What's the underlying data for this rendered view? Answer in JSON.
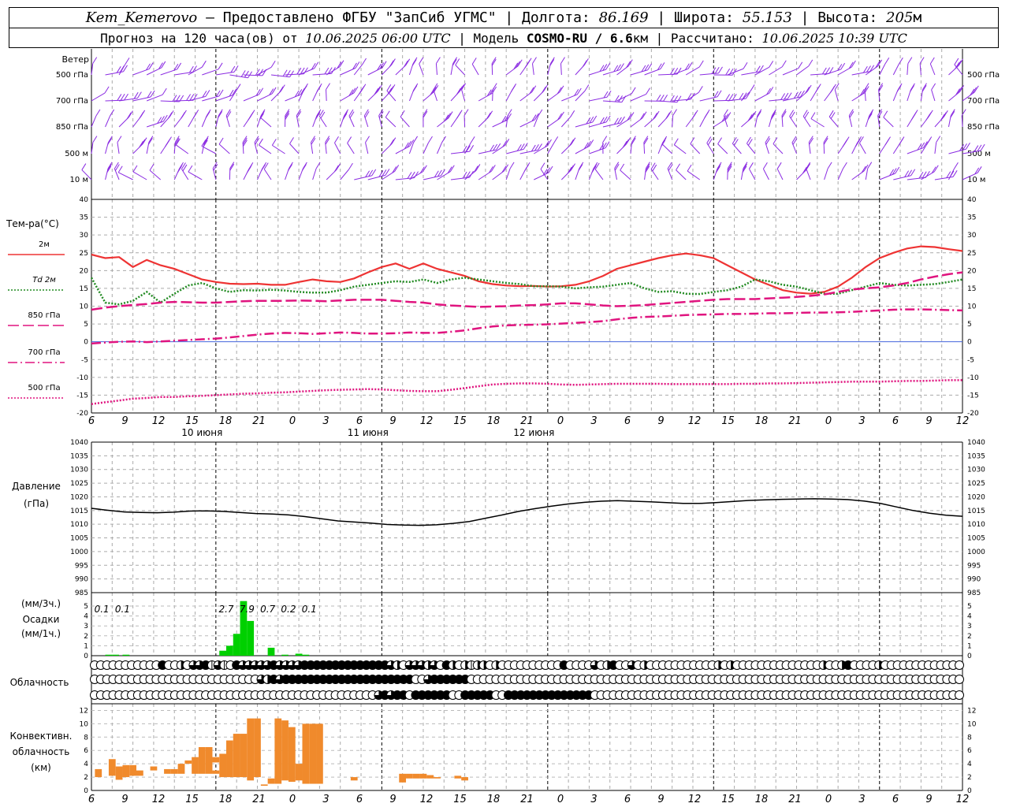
{
  "header": {
    "station": "Kem_Kemerovo",
    "provider": " — Предоставлено ФГБУ \"ЗапСиб УГМС\"",
    "lon_label": " | Долгота: ",
    "lon": "86.169",
    "lat_label": " | Широта: ",
    "lat": "55.153",
    "alt_label": " | Высота: ",
    "alt": "205",
    "alt_unit": "м",
    "forecast_label": "Прогноз на 120 часа(ов) от ",
    "start": "10.06.2025 06:00 UTC",
    "model_label": "  | Модель ",
    "model": "COSMO-RU / 6.6",
    "model_unit": "км",
    "calc_label": " | Рассчитано: ",
    "calc": "10.06.2025 10:39 UTC"
  },
  "chart_data": {
    "type": "meteogram",
    "x_hours": [
      6,
      9,
      12,
      15,
      18,
      21,
      0,
      3,
      6,
      9,
      12,
      15,
      18,
      21,
      0,
      3,
      6,
      9,
      12,
      15,
      18,
      21,
      0,
      3,
      6,
      9,
      12
    ],
    "days": [
      "10 июня",
      "11 июня",
      "12 июня"
    ],
    "wind": {
      "title": "Ветер",
      "levels": [
        "500 гПа",
        "700 гПа",
        "850 гПа",
        "500 м",
        "10 м"
      ],
      "color": "#8a2be2"
    },
    "temperature": {
      "title": "Тем-ра(°C)",
      "ylim": [
        -20,
        40
      ],
      "yticks": [
        40,
        35,
        30,
        25,
        20,
        15,
        10,
        5,
        0,
        -5,
        -10,
        -15,
        -20
      ],
      "series": [
        {
          "name": "2м",
          "color": "#ee3333",
          "dash": "solid",
          "values": [
            24.5,
            23.5,
            23.8,
            21.0,
            23.0,
            21.5,
            20.5,
            19.0,
            17.5,
            16.8,
            16.3,
            16.2,
            16.3,
            16.0,
            16.0,
            16.8,
            17.5,
            17.0,
            16.8,
            17.8,
            19.5,
            21.0,
            22.0,
            20.5,
            22.0,
            20.5,
            19.5,
            18.5,
            17.0,
            16.2,
            15.8,
            15.6,
            15.7,
            15.5,
            15.6,
            16.0,
            17.0,
            18.5,
            20.5,
            21.5,
            22.5,
            23.5,
            24.3,
            24.8,
            24.3,
            23.5,
            21.5,
            19.5,
            17.5,
            16.0,
            14.5,
            13.8,
            13.5,
            14.0,
            15.5,
            18.0,
            21.0,
            23.5,
            25.0,
            26.2,
            26.8,
            26.6,
            26.0,
            25.5
          ]
        },
        {
          "name": "Td 2м",
          "color": "#228b22",
          "dash": "dotted",
          "values": [
            18.0,
            11.0,
            10.5,
            11.5,
            14.0,
            11.0,
            13.5,
            15.8,
            16.5,
            15.0,
            14.0,
            14.5,
            14.4,
            14.6,
            14.4,
            14.0,
            13.8,
            13.8,
            14.5,
            15.5,
            16.0,
            16.5,
            17.0,
            16.8,
            17.5,
            16.5,
            17.5,
            18.0,
            17.5,
            17.0,
            16.5,
            16.2,
            15.6,
            15.6,
            15.5,
            15.0,
            15.3,
            15.5,
            16.0,
            16.5,
            15.0,
            14.0,
            14.2,
            13.5,
            13.4,
            14.0,
            14.5,
            15.5,
            17.5,
            17.0,
            16.0,
            15.5,
            14.5,
            13.5,
            13.5,
            14.5,
            15.5,
            16.5,
            16.0,
            15.8,
            16.0,
            16.2,
            16.8,
            17.5
          ]
        },
        {
          "name": "850 гПа",
          "color": "#e0147f",
          "dash": "long-dash",
          "values": [
            9.0,
            9.6,
            10.0,
            10.3,
            10.6,
            11.0,
            11.2,
            11.1,
            11.0,
            11.0,
            11.2,
            11.4,
            11.5,
            11.5,
            11.5,
            11.6,
            11.5,
            11.4,
            11.6,
            11.8,
            11.8,
            11.8,
            11.5,
            11.2,
            11.0,
            10.5,
            10.2,
            10.0,
            9.8,
            9.9,
            10.0,
            10.2,
            10.3,
            10.5,
            10.8,
            10.8,
            10.5,
            10.2,
            10.0,
            10.1,
            10.3,
            10.6,
            10.9,
            11.2,
            11.5,
            11.8,
            12.0,
            12.0,
            12.0,
            12.2,
            12.4,
            12.6,
            12.9,
            13.3,
            14.0,
            14.7,
            15.0,
            15.3,
            15.8,
            16.5,
            17.5,
            18.3,
            19.0,
            19.5
          ]
        },
        {
          "name": "700 гПа",
          "color": "#e0147f",
          "dash": "dash-dot",
          "values": [
            -0.5,
            -0.2,
            0.0,
            0.1,
            -0.1,
            0.1,
            0.3,
            0.5,
            0.7,
            0.9,
            1.2,
            1.6,
            2.0,
            2.3,
            2.5,
            2.4,
            2.2,
            2.4,
            2.6,
            2.5,
            2.3,
            2.3,
            2.4,
            2.6,
            2.5,
            2.5,
            2.8,
            3.2,
            3.8,
            4.3,
            4.6,
            4.7,
            4.8,
            4.9,
            5.1,
            5.3,
            5.5,
            5.8,
            6.3,
            6.7,
            7.0,
            7.1,
            7.3,
            7.5,
            7.6,
            7.7,
            7.8,
            7.8,
            7.9,
            8.0,
            8.0,
            8.1,
            8.2,
            8.2,
            8.3,
            8.4,
            8.6,
            8.8,
            9.0,
            9.1,
            9.1,
            9.0,
            8.9,
            8.8
          ]
        },
        {
          "name": "500 гПа",
          "color": "#e0147f",
          "dash": "dotted",
          "values": [
            -17.5,
            -17.0,
            -16.5,
            -16.0,
            -15.8,
            -15.5,
            -15.5,
            -15.3,
            -15.2,
            -15.0,
            -14.8,
            -14.6,
            -14.5,
            -14.3,
            -14.2,
            -14.0,
            -13.8,
            -13.6,
            -13.5,
            -13.4,
            -13.3,
            -13.4,
            -13.6,
            -13.8,
            -13.9,
            -13.9,
            -13.5,
            -13.0,
            -12.5,
            -12.0,
            -11.8,
            -11.7,
            -11.7,
            -11.8,
            -12.0,
            -12.1,
            -12.0,
            -11.9,
            -11.8,
            -11.8,
            -11.8,
            -11.8,
            -11.9,
            -11.9,
            -11.9,
            -11.9,
            -11.9,
            -11.8,
            -11.8,
            -11.7,
            -11.7,
            -11.6,
            -11.5,
            -11.4,
            -11.3,
            -11.2,
            -11.2,
            -11.2,
            -11.1,
            -11.0,
            -11.0,
            -10.9,
            -10.8,
            -10.8
          ]
        }
      ]
    },
    "pressure": {
      "title": "Давление",
      "unit": "(гПа)",
      "ylim": [
        985,
        1040
      ],
      "yticks": [
        1040,
        1035,
        1030,
        1025,
        1020,
        1015,
        1010,
        1005,
        1000,
        995,
        990,
        985
      ],
      "values": [
        1015.8,
        1015.1,
        1014.5,
        1014.3,
        1014.2,
        1014.4,
        1014.8,
        1014.9,
        1014.7,
        1014.3,
        1013.9,
        1013.7,
        1013.4,
        1012.8,
        1012.0,
        1011.2,
        1010.8,
        1010.4,
        1009.9,
        1009.7,
        1009.6,
        1009.8,
        1010.3,
        1011.0,
        1012.2,
        1013.4,
        1014.7,
        1015.7,
        1016.6,
        1017.4,
        1018.0,
        1018.4,
        1018.6,
        1018.4,
        1018.2,
        1017.9,
        1017.6,
        1017.6,
        1017.9,
        1018.3,
        1018.7,
        1018.9,
        1019.1,
        1019.2,
        1019.3,
        1019.2,
        1019.0,
        1018.5,
        1017.6,
        1016.3,
        1015.0,
        1014.0,
        1013.3,
        1012.9
      ]
    },
    "precipitation": {
      "title": "Осадки",
      "unit_3h": "(мм/3ч.)",
      "unit_1h": "(мм/1ч.)",
      "ylim": [
        0,
        5
      ],
      "yticks": [
        5,
        4,
        3,
        2,
        1,
        0
      ],
      "labels": [
        {
          "hour": 1.5,
          "text": "0.1"
        },
        {
          "hour": 4.5,
          "text": "0.1"
        },
        {
          "hour": 19.5,
          "text": "2.7"
        },
        {
          "hour": 22.5,
          "text": "7.9"
        },
        {
          "hour": 25.5,
          "text": "0.7"
        },
        {
          "hour": 28.5,
          "text": "0.2"
        },
        {
          "hour": 31.5,
          "text": "0.1"
        }
      ],
      "bars": [
        {
          "hour": 2.5,
          "mm": 0.1
        },
        {
          "hour": 3.5,
          "mm": 0.1
        },
        {
          "hour": 5,
          "mm": 0.1
        },
        {
          "hour": 19,
          "mm": 0.5
        },
        {
          "hour": 20,
          "mm": 1.0
        },
        {
          "hour": 21,
          "mm": 2.2
        },
        {
          "hour": 22,
          "mm": 5.5
        },
        {
          "hour": 23,
          "mm": 3.5
        },
        {
          "hour": 26,
          "mm": 0.8
        },
        {
          "hour": 28,
          "mm": 0.1
        },
        {
          "hour": 30,
          "mm": 0.2
        },
        {
          "hour": 31,
          "mm": 0.1
        }
      ],
      "bar_color": "#00d000"
    },
    "cloudiness": {
      "title": "Облачность",
      "rows": [
        "000000000004002033413104333334333344444444444444320333230420212202000000000040000302400302000000000002020000000000000020024000020000000000000",
        "000000000000000000000000000324344444444444444444444400344444400000000000000000000000000000000000000000000000000000000000000000000000000000000",
        "000000000000000000000000000000000000000000000034344044444400444440044444444444444000000000000000000000000000000000000000000000000000000000000"
      ]
    },
    "convective": {
      "title_1": "Конвективн.",
      "title_2": "облачность",
      "unit": "(км)",
      "ylim": [
        0,
        13
      ],
      "yticks": [
        12,
        10,
        8,
        6,
        4,
        2,
        0
      ],
      "bar_color": "#f08a2c",
      "bars": [
        {
          "h0": 0.5,
          "h1": 1.5,
          "lo": 2.0,
          "hi": 3.2
        },
        {
          "h0": 2.5,
          "h1": 3.5,
          "lo": 2.2,
          "hi": 4.7
        },
        {
          "h0": 3.5,
          "h1": 4.5,
          "lo": 1.6,
          "hi": 3.6
        },
        {
          "h0": 4.5,
          "h1": 5.5,
          "lo": 2.0,
          "hi": 3.8
        },
        {
          "h0": 5.5,
          "h1": 6.5,
          "lo": 2.2,
          "hi": 3.8
        },
        {
          "h0": 6.5,
          "h1": 7.5,
          "lo": 2.2,
          "hi": 3.0
        },
        {
          "h0": 8.5,
          "h1": 9.5,
          "lo": 3.0,
          "hi": 3.6
        },
        {
          "h0": 10.5,
          "h1": 11.5,
          "lo": 2.5,
          "hi": 3.2
        },
        {
          "h0": 11.5,
          "h1": 12.5,
          "lo": 2.5,
          "hi": 3.2
        },
        {
          "h0": 12.5,
          "h1": 13.5,
          "lo": 2.5,
          "hi": 4.0
        },
        {
          "h0": 13.5,
          "h1": 14.5,
          "lo": 4.0,
          "hi": 4.5
        },
        {
          "h0": 14.5,
          "h1": 15.5,
          "lo": 2.5,
          "hi": 5.0
        },
        {
          "h0": 15.5,
          "h1": 16.5,
          "lo": 2.5,
          "hi": 6.5
        },
        {
          "h0": 16.5,
          "h1": 17.5,
          "lo": 2.5,
          "hi": 6.5
        },
        {
          "h0": 17.5,
          "h1": 18.5,
          "lo": 2.5,
          "hi": 3.0
        },
        {
          "h0": 17.5,
          "h1": 18.5,
          "lo": 4.2,
          "hi": 5.0
        },
        {
          "h0": 18.5,
          "h1": 19.5,
          "lo": 2.0,
          "hi": 5.5
        },
        {
          "h0": 19.5,
          "h1": 20.5,
          "lo": 2.0,
          "hi": 7.5
        },
        {
          "h0": 20.5,
          "h1": 21.5,
          "lo": 2.0,
          "hi": 8.5
        },
        {
          "h0": 21.5,
          "h1": 22.5,
          "lo": 2.0,
          "hi": 8.5
        },
        {
          "h0": 22.5,
          "h1": 23.5,
          "lo": 1.5,
          "hi": 10.8
        },
        {
          "h0": 23.5,
          "h1": 24.5,
          "lo": 2.0,
          "hi": 10.8
        },
        {
          "h0": 24.5,
          "h1": 25.5,
          "lo": 0.7,
          "hi": 0.9
        },
        {
          "h0": 25.5,
          "h1": 26.5,
          "lo": 1.0,
          "hi": 1.8
        },
        {
          "h0": 26.5,
          "h1": 27.5,
          "lo": 1.0,
          "hi": 10.8
        },
        {
          "h0": 27.5,
          "h1": 28.5,
          "lo": 1.5,
          "hi": 10.5
        },
        {
          "h0": 28.5,
          "h1": 29.5,
          "lo": 1.3,
          "hi": 9.5
        },
        {
          "h0": 29.5,
          "h1": 30.5,
          "lo": 1.5,
          "hi": 4.0
        },
        {
          "h0": 30.5,
          "h1": 31.5,
          "lo": 1.0,
          "hi": 10.0
        },
        {
          "h0": 31.5,
          "h1": 32.5,
          "lo": 1.0,
          "hi": 10.0
        },
        {
          "h0": 32.5,
          "h1": 33.5,
          "lo": 1.0,
          "hi": 10.0
        },
        {
          "h0": 37.5,
          "h1": 38.5,
          "lo": 1.5,
          "hi": 2.0
        },
        {
          "h0": 44.5,
          "h1": 45.5,
          "lo": 1.2,
          "hi": 2.5
        },
        {
          "h0": 45.5,
          "h1": 46.5,
          "lo": 1.8,
          "hi": 2.5
        },
        {
          "h0": 46.5,
          "h1": 47.5,
          "lo": 1.8,
          "hi": 2.5
        },
        {
          "h0": 47.5,
          "h1": 48.5,
          "lo": 1.8,
          "hi": 2.5
        },
        {
          "h0": 48.5,
          "h1": 49.5,
          "lo": 1.8,
          "hi": 2.3
        },
        {
          "h0": 49.5,
          "h1": 50.5,
          "lo": 1.8,
          "hi": 2.0
        },
        {
          "h0": 52.5,
          "h1": 53.5,
          "lo": 1.8,
          "hi": 2.2
        },
        {
          "h0": 53.5,
          "h1": 54.5,
          "lo": 1.5,
          "hi": 2.0
        }
      ]
    }
  }
}
